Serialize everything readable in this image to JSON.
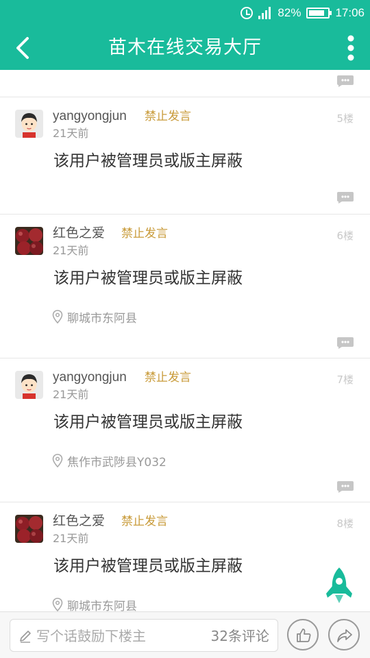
{
  "status_bar": {
    "battery": "82%",
    "time": "17:06",
    "signal": "4G",
    "icons": [
      "alarm-icon",
      "signal-icon",
      "battery-icon"
    ]
  },
  "header": {
    "title": "苗木在线交易大厅",
    "back_icon": "chevron-left-icon",
    "more_icon": "more-vertical-icon"
  },
  "posts": [
    {
      "username": "yangyongjun",
      "badge": "禁止发言",
      "time": "21天前",
      "floor": "5楼",
      "content": "该用户被管理员或版主屏蔽",
      "location": "",
      "avatar": "cartoon-boy"
    },
    {
      "username": "红色之爱",
      "badge": "禁止发言",
      "time": "21天前",
      "floor": "6楼",
      "content": "该用户被管理员或版主屏蔽",
      "location": "聊城市东阿县",
      "avatar": "apples"
    },
    {
      "username": "yangyongjun",
      "badge": "禁止发言",
      "time": "21天前",
      "floor": "7楼",
      "content": "该用户被管理员或版主屏蔽",
      "location": "焦作市武陟县Y032",
      "avatar": "cartoon-boy"
    },
    {
      "username": "红色之爱",
      "badge": "禁止发言",
      "time": "21天前",
      "floor": "8楼",
      "content": "该用户被管理员或版主屏蔽",
      "location": "聊城市东阿县",
      "avatar": "apples"
    }
  ],
  "bottom_bar": {
    "placeholder": "写个话鼓励下楼主",
    "comment_count": "32条评论",
    "like_icon": "thumbs-up-icon",
    "share_icon": "share-icon"
  },
  "colors": {
    "primary": "#19bb9b",
    "badge": "#c89a38"
  }
}
